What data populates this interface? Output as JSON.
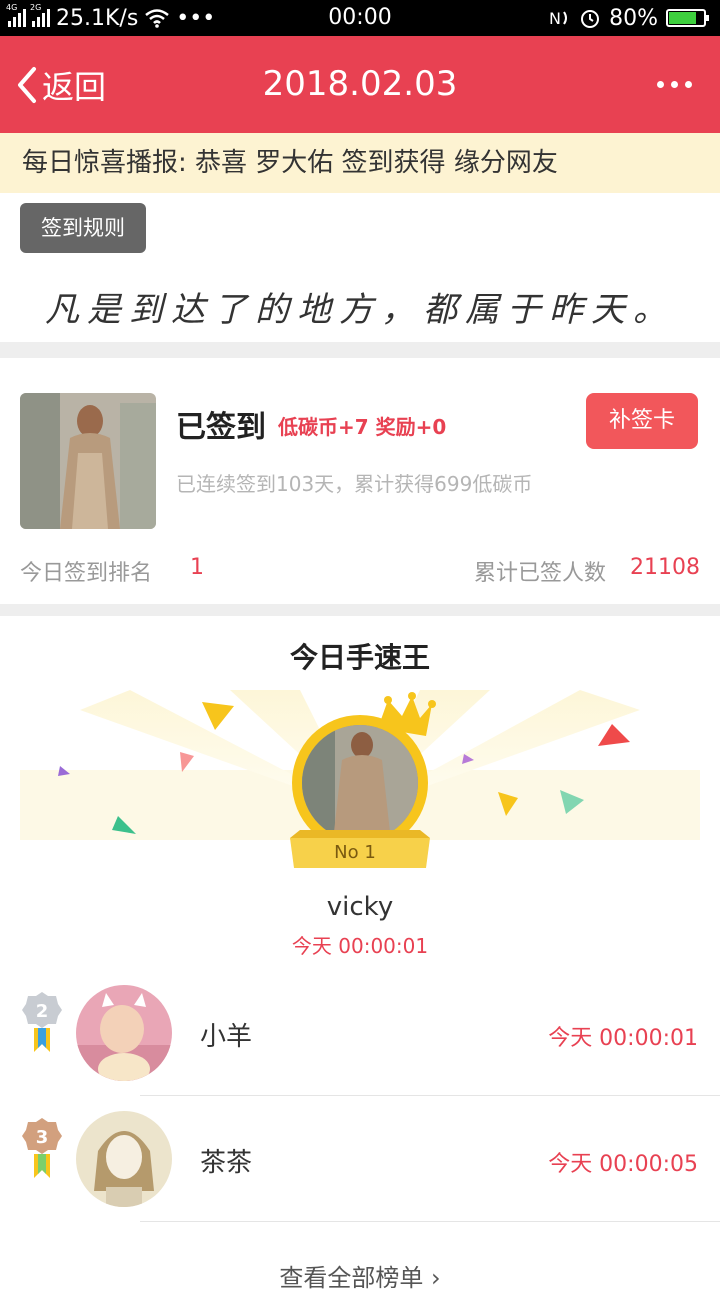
{
  "status_bar": {
    "network_4g": "4G",
    "network_2g": "2G",
    "speed": "25.1K/s",
    "more": "•••",
    "time": "00:00",
    "battery": "80%",
    "battery_level": 0.8
  },
  "nav": {
    "back_label": "返回",
    "title": "2018.02.03"
  },
  "announcement": "每日惊喜播报: 恭喜 罗大佑 签到获得 缘分网友",
  "rules_button": "签到规则",
  "quote": "凡是到达了的地方，都属于昨天。",
  "sign_card": {
    "status": "已签到",
    "reward": "低碳币+7 奖励+0",
    "makeup_button": "补签卡",
    "streak_text": "已连续签到103天，累计获得699低碳币",
    "rank_label": "今日签到排名",
    "rank_value": "1",
    "total_label": "累计已签人数",
    "total_value": "21108"
  },
  "speed_king": {
    "title": "今日手速王",
    "champion": {
      "badge": "No 1",
      "name": "vicky",
      "time": "今天 00:00:01"
    },
    "ranks": [
      {
        "rank": "2",
        "name": "小羊",
        "time": "今天 00:00:01"
      },
      {
        "rank": "3",
        "name": "茶茶",
        "time": "今天 00:00:05"
      }
    ],
    "view_all": "查看全部榜单 ›"
  },
  "colors": {
    "brand_red": "#e84152",
    "announce_bg": "#fdf3d2",
    "accent_gold": "#f7c51c"
  }
}
